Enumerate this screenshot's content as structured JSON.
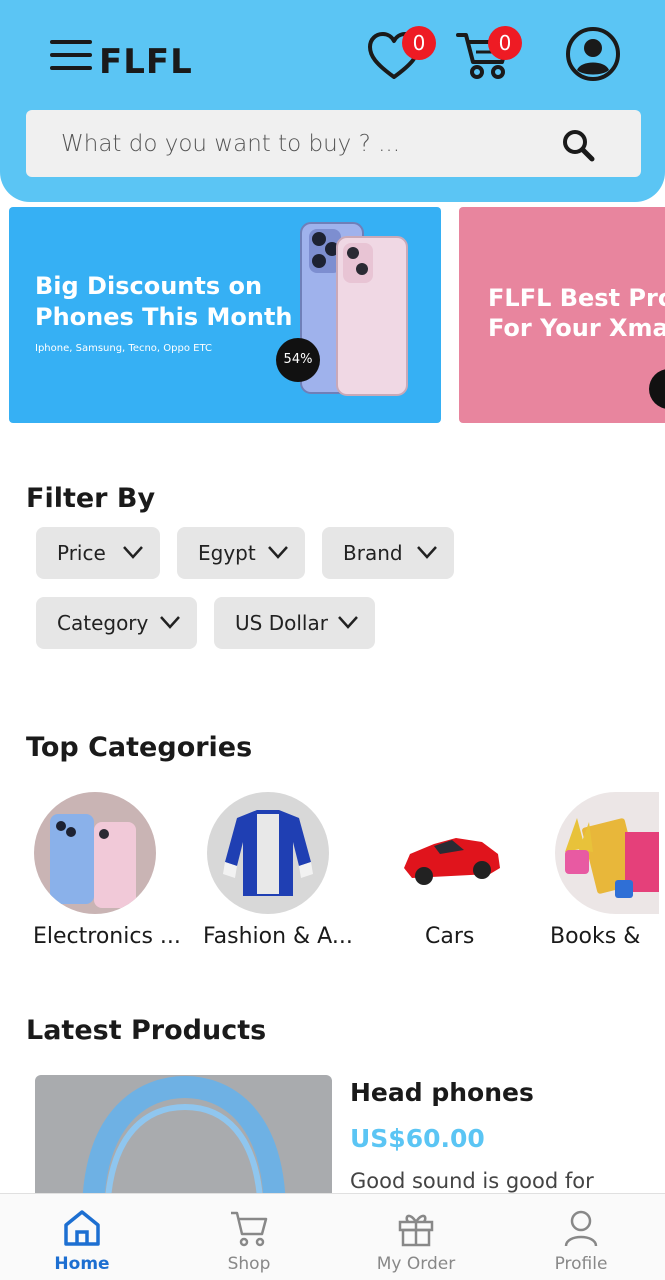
{
  "header": {
    "logo": "FLFL",
    "wishlist_count": "0",
    "cart_count": "0",
    "search_placeholder": "What do you want to buy ? ..."
  },
  "banners": [
    {
      "title_line1": "Big Discounts on",
      "title_line2": "Phones This Month",
      "subtitle": "Iphone, Samsung, Tecno, Oppo ETC",
      "badge": "54%",
      "color": "#36b0f4"
    },
    {
      "title_line1": "FLFL Best Pro",
      "title_line2": "For Your Xmas",
      "color": "#e8859e"
    }
  ],
  "filter": {
    "title": "Filter By",
    "chips": [
      {
        "label": "Price"
      },
      {
        "label": "Egypt"
      },
      {
        "label": "Brand"
      },
      {
        "label": "Category"
      },
      {
        "label": "US Dollar"
      }
    ]
  },
  "categories": {
    "title": "Top Categories",
    "items": [
      {
        "label": "Electronics ..."
      },
      {
        "label": "Fashion & A..."
      },
      {
        "label": "Cars"
      },
      {
        "label": "Books &"
      }
    ]
  },
  "latest": {
    "title": "Latest Products",
    "product": {
      "name": "Head phones",
      "price": "US$60.00",
      "description": "Good sound is good for"
    }
  },
  "nav": {
    "items": [
      {
        "label": "Home",
        "active": true
      },
      {
        "label": "Shop"
      },
      {
        "label": "My Order"
      },
      {
        "label": "Profile"
      }
    ]
  },
  "colors": {
    "accent": "#5bc5f4",
    "badge": "#ee1b24",
    "nav_active": "#1d6fd1"
  }
}
